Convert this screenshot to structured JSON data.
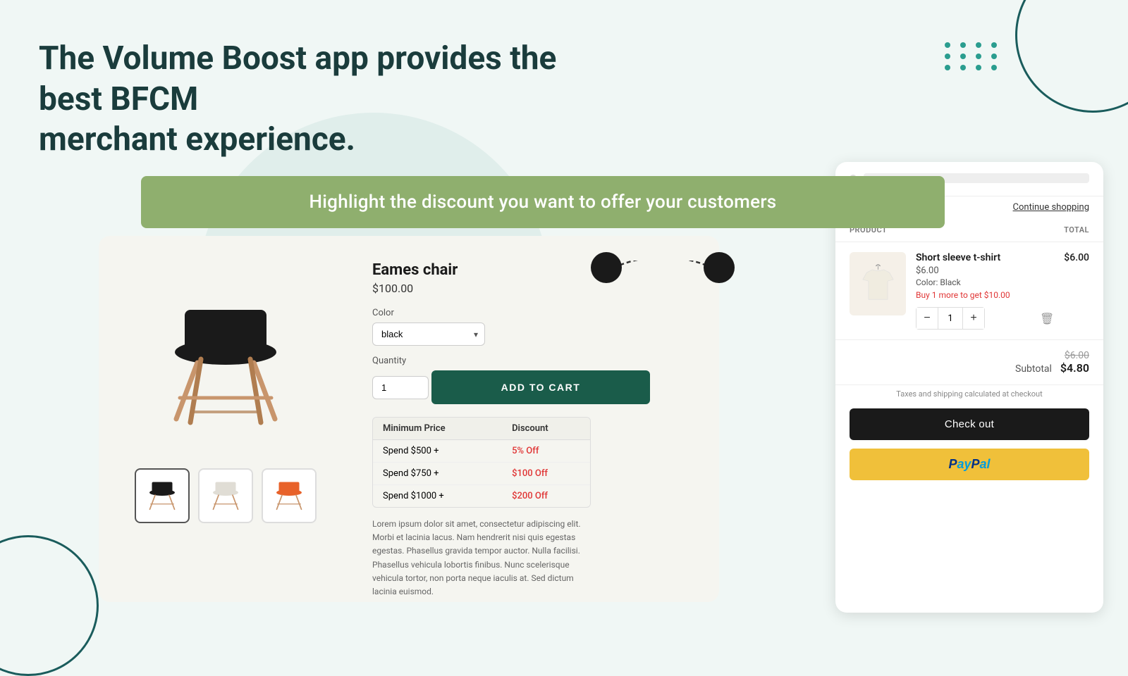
{
  "headline": {
    "line1": "The Volume Boost app provides the best BFCM",
    "line2": "merchant experience."
  },
  "banner": {
    "text": "Highlight the discount you want to offer your customers"
  },
  "product": {
    "name": "Eames chair",
    "price": "$100.00",
    "color_label": "Color",
    "color_value": "black",
    "quantity_label": "Quantity",
    "quantity_value": "1",
    "add_to_cart": "ADD TO CART",
    "discount_table": {
      "col1": "Minimum Price",
      "col2": "Discount",
      "rows": [
        {
          "min": "Spend $500 +",
          "discount": "5% Off"
        },
        {
          "min": "Spend $750 +",
          "discount": "$100 Off"
        },
        {
          "min": "Spend $1000 +",
          "discount": "$200 Off"
        }
      ]
    },
    "lorem": "Lorem ipsum dolor sit amet, consectetur adipiscing elit. Morbi et lacinia lacus. Nam hendrerit nisi quis egestas egestas. Phasellus gravida tempor auctor. Nulla facilisi. Phasellus vehicula lobortis finibus. Nunc scelerisque vehicula tortor, non porta neque iaculis at. Sed dictum lacinia euismod."
  },
  "cart": {
    "continue_shopping": "Continue shopping",
    "col_product": "PRODUCT",
    "col_total": "TOTAL",
    "item": {
      "name": "Short sleeve t-shirt",
      "price": "$6.00",
      "color": "Color: Black",
      "upsell": "Buy 1 more to get $10.00",
      "quantity": "1",
      "total": "$6.00"
    },
    "subtotal_label": "Subtotal",
    "subtotal_original": "$6.00",
    "subtotal_discounted": "$4.80",
    "taxes_note": "Taxes and shipping calculated at checkout",
    "checkout_btn": "Check out",
    "paypal_label": "PayPal"
  }
}
